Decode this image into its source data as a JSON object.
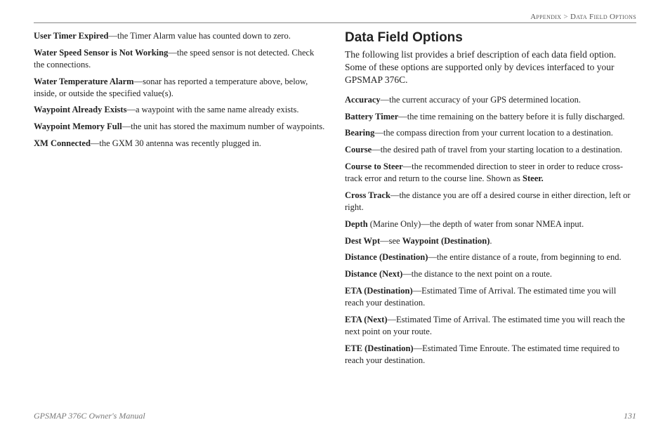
{
  "header": {
    "breadcrumb_a": "Appendix",
    "breadcrumb_sep": ">",
    "breadcrumb_b": "Data Field Options"
  },
  "left": {
    "items": [
      {
        "term": "User Timer Expired",
        "desc": "—the Timer Alarm value has counted down to zero."
      },
      {
        "term": "Water Speed Sensor is Not Working",
        "desc": "—the speed sensor is not detected. Check the connections."
      },
      {
        "term": "Water Temperature Alarm",
        "desc": "—sonar has reported a temperature above, below, inside, or outside the specified value(s)."
      },
      {
        "term": "Waypoint Already Exists",
        "desc": "—a waypoint with the same name already exists."
      },
      {
        "term": "Waypoint Memory Full",
        "desc": "—the unit has stored the maximum number of waypoints."
      },
      {
        "term": "XM Connected",
        "desc": "—the GXM 30 antenna was recently plugged in."
      }
    ]
  },
  "right": {
    "section_title": "Data Field Options",
    "intro": "The following list provides a brief description of each data field option. Some of these options are supported only by devices interfaced to your GPSMAP 376C.",
    "items": [
      {
        "term": "Accuracy",
        "desc": "—the current accuracy of your GPS determined location."
      },
      {
        "term": "Battery Timer",
        "desc": "—the time remaining on the battery before it is fully discharged."
      },
      {
        "term": "Bearing",
        "desc": "—the compass direction from your current location to a destination."
      },
      {
        "term": "Course",
        "desc": "—the desired path of travel from your starting location to a destination."
      },
      {
        "term": "Course to Steer",
        "desc": "—the recommended direction to steer in order to reduce cross-track error and return to the course line. Shown as ",
        "tail_bold": "Steer."
      },
      {
        "term": "Cross Track",
        "desc": "—the distance you are off a desired course in either direction, left or right."
      },
      {
        "term": "Depth",
        "post": " (Marine Only)",
        "desc": "—the depth of water from sonar NMEA input."
      },
      {
        "term": "Dest Wpt",
        "desc": "—see ",
        "tail_bold": "Waypoint (Destination)",
        "tail_after": "."
      },
      {
        "term": "Distance (Destination)",
        "desc": "—the entire distance of a route, from beginning to end."
      },
      {
        "term": "Distance (Next)",
        "desc": "—the distance to the next point on a route."
      },
      {
        "term": "ETA (Destination)",
        "desc": "—Estimated Time of Arrival. The estimated time you will reach your destination."
      },
      {
        "term": "ETA (Next)",
        "desc": "—Estimated Time of Arrival. The estimated time you will reach the next point on your route."
      },
      {
        "term": "ETE (Destination)",
        "desc": "—Estimated Time Enroute. The estimated time required to reach your destination."
      }
    ]
  },
  "footer": {
    "manual": "GPSMAP 376C Owner's Manual",
    "page": "131"
  }
}
